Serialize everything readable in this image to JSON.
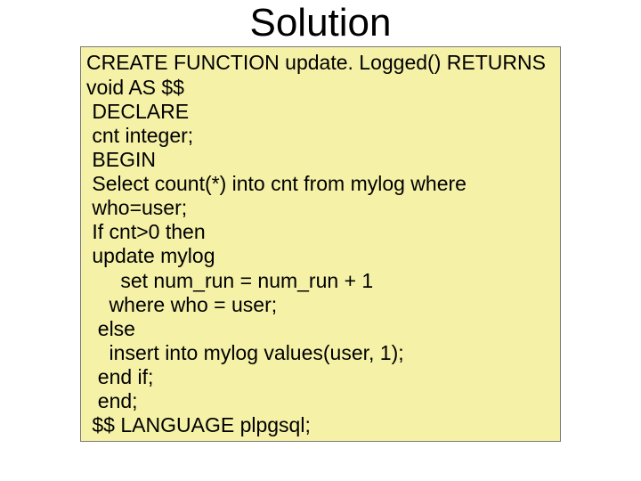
{
  "title": "Solution",
  "code": {
    "l0": "CREATE FUNCTION update. Logged() RETURNS",
    "l1": "void AS $$",
    "l2": " DECLARE",
    "l3": " cnt integer;",
    "l4": " BEGIN",
    "l5": " Select count(*) into cnt from mylog where",
    "l6": " who=user;",
    "l7": " If cnt>0 then",
    "l8": " update mylog",
    "l9": "      set num_run = num_run + 1",
    "l10": "    where who = user;",
    "l11": "  else",
    "l12": "    insert into mylog values(user, 1);",
    "l13": "  end if;",
    "l14": "  end;",
    "l15": " $$ LANGUAGE plpgsql;"
  }
}
